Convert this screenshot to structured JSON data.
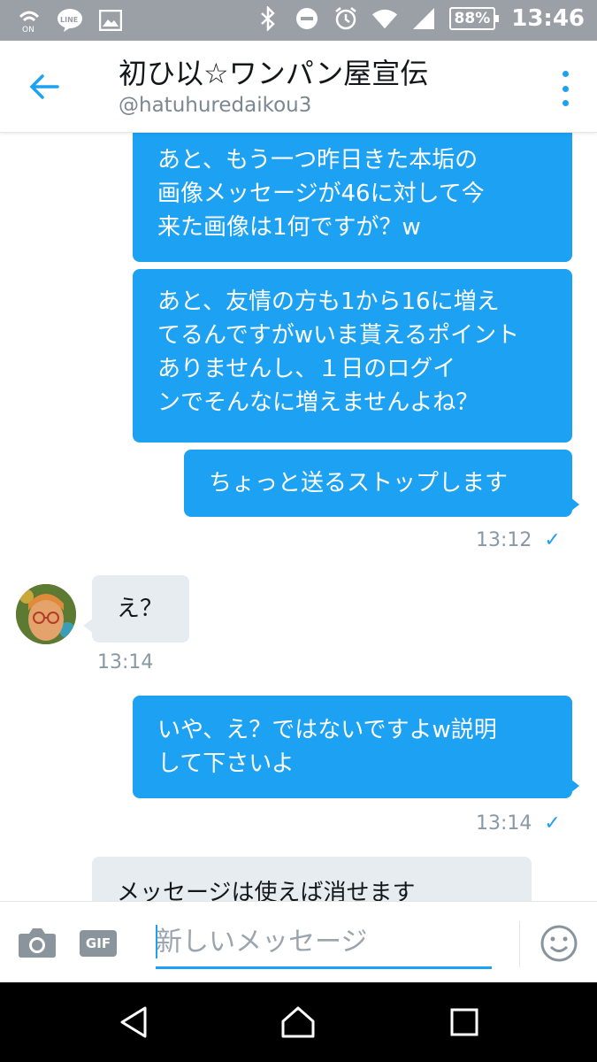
{
  "status_bar": {
    "battery": "88%",
    "time": "13:46",
    "left_icons": [
      "wifi-calling-icon",
      "line-app-icon",
      "image-icon"
    ],
    "right_icons": [
      "bluetooth-icon",
      "do-not-disturb-icon",
      "alarm-icon",
      "wifi-icon",
      "signal-icon"
    ]
  },
  "header": {
    "title": "初ひ以☆ワンパン屋宣伝",
    "handle": "@hatuhuredaikou3",
    "accent": "#1da1f2"
  },
  "messages": [
    {
      "direction": "out",
      "lines": [
        "あと、もう一つ昨日きた本垢の",
        "画像メッセージが46に対して今",
        "来た画像は1何ですが？w"
      ]
    },
    {
      "direction": "out",
      "lines": [
        "あと、友情の方も1から16に増え",
        "てるんですがwいま貰えるポイント",
        "ありませんし、１日のログイ",
        "ンでそんなに増えませんよね？"
      ]
    },
    {
      "direction": "out",
      "lines": [
        "ちょっと送るストップします"
      ]
    },
    {
      "direction": "in",
      "lines": [
        "え？"
      ]
    },
    {
      "direction": "out",
      "lines": [
        "いや、え？ではないですよw説明",
        "して下さいよ"
      ]
    },
    {
      "direction": "in",
      "lines": [
        "メッセージは使えば消せます"
      ]
    }
  ],
  "timestamps": {
    "t1": "13:12",
    "t2": "13:14",
    "t3": "13:14"
  },
  "compose": {
    "gif_label": "GIF",
    "placeholder": "新しいメッセージ"
  },
  "colors": {
    "bubble_out": "#1da1f2",
    "bubble_in": "#e6ecf0",
    "status_bar": "#9aa0a6"
  }
}
